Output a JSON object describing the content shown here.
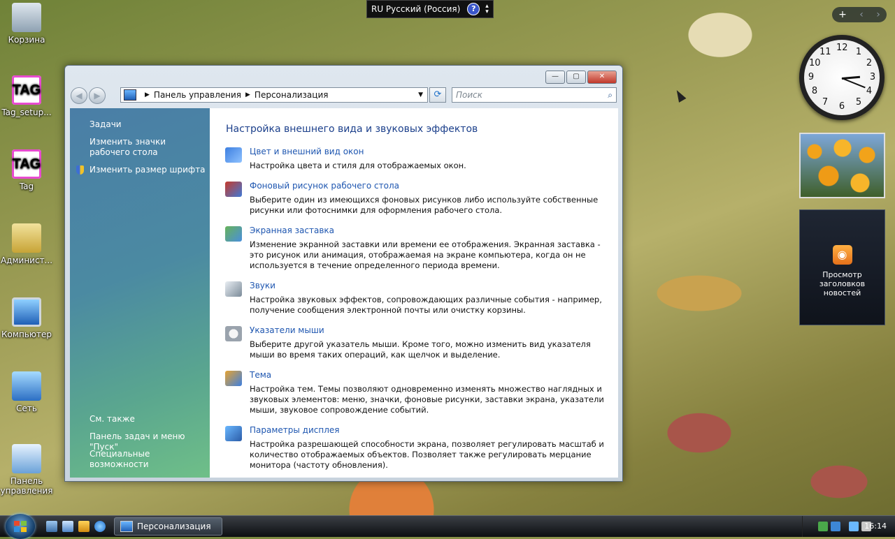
{
  "desktop": {
    "icons": [
      {
        "label": "Корзина"
      },
      {
        "label": "Tag_setup..."
      },
      {
        "label": "Tag"
      },
      {
        "label": "Админист..."
      },
      {
        "label": "Компьютер"
      },
      {
        "label": "Сеть"
      },
      {
        "label": "Панель управления"
      }
    ]
  },
  "langbar": {
    "text": "RU Русский (Россия)",
    "help": "?"
  },
  "sidebar": {
    "add": "+",
    "prev": "‹",
    "next": "›",
    "clock": {
      "time": "4:14"
    },
    "feeds": {
      "label": "Просмотр заголовков новостей",
      "icon": "rss-icon"
    }
  },
  "window": {
    "controls": {
      "minimize": "—",
      "maximize": "▢",
      "close": "✕"
    },
    "breadcrumb": [
      "Панель управления",
      "Персонализация"
    ],
    "search_placeholder": "Поиск",
    "left_pane": {
      "tasks_heading": "Задачи",
      "tasks": [
        "Изменить значки рабочего стола",
        "Изменить размер шрифта"
      ],
      "see_also_heading": "См. также",
      "see_also": [
        "Панель задач и меню \"Пуск\"",
        "Специальные возможности"
      ]
    },
    "heading": "Настройка внешнего вида и звуковых эффектов",
    "items": [
      {
        "title": "Цвет и внешний вид окон",
        "desc": "Настройка цвета и стиля для отображаемых окон."
      },
      {
        "title": "Фоновый рисунок рабочего стола",
        "desc": "Выберите один из имеющихся фоновых рисунков либо используйте собственные рисунки или фотоснимки для оформления рабочего стола."
      },
      {
        "title": "Экранная заставка",
        "desc": "Изменение экранной заставки или времени ее отображения. Экранная заставка - это рисунок или анимация, отображаемая на экране компьютера, когда он не используется в течение определенного периода времени."
      },
      {
        "title": "Звуки",
        "desc": "Настройка звуковых эффектов, сопровождающих различные события - например, получение сообщения электронной почты или очистку корзины."
      },
      {
        "title": "Указатели мыши",
        "desc": "Выберите другой указатель мыши. Кроме того, можно изменить вид указателя мыши во время таких операций, как щелчок и выделение."
      },
      {
        "title": "Тема",
        "desc": "Настройка тем. Темы позволяют одновременно изменять множество наглядных и звуковых элементов: меню, значки, фоновые рисунки, заставки экрана, указатели мыши, звуковое сопровождение событий."
      },
      {
        "title": "Параметры дисплея",
        "desc": "Настройка разрешающей способности экрана, позволяет регулировать масштаб и количество отображаемых объектов. Позволяет также регулировать мерцание монитора (частоту обновления)."
      }
    ]
  },
  "taskbar": {
    "active_window": "Персонализация",
    "time": "16:14"
  }
}
